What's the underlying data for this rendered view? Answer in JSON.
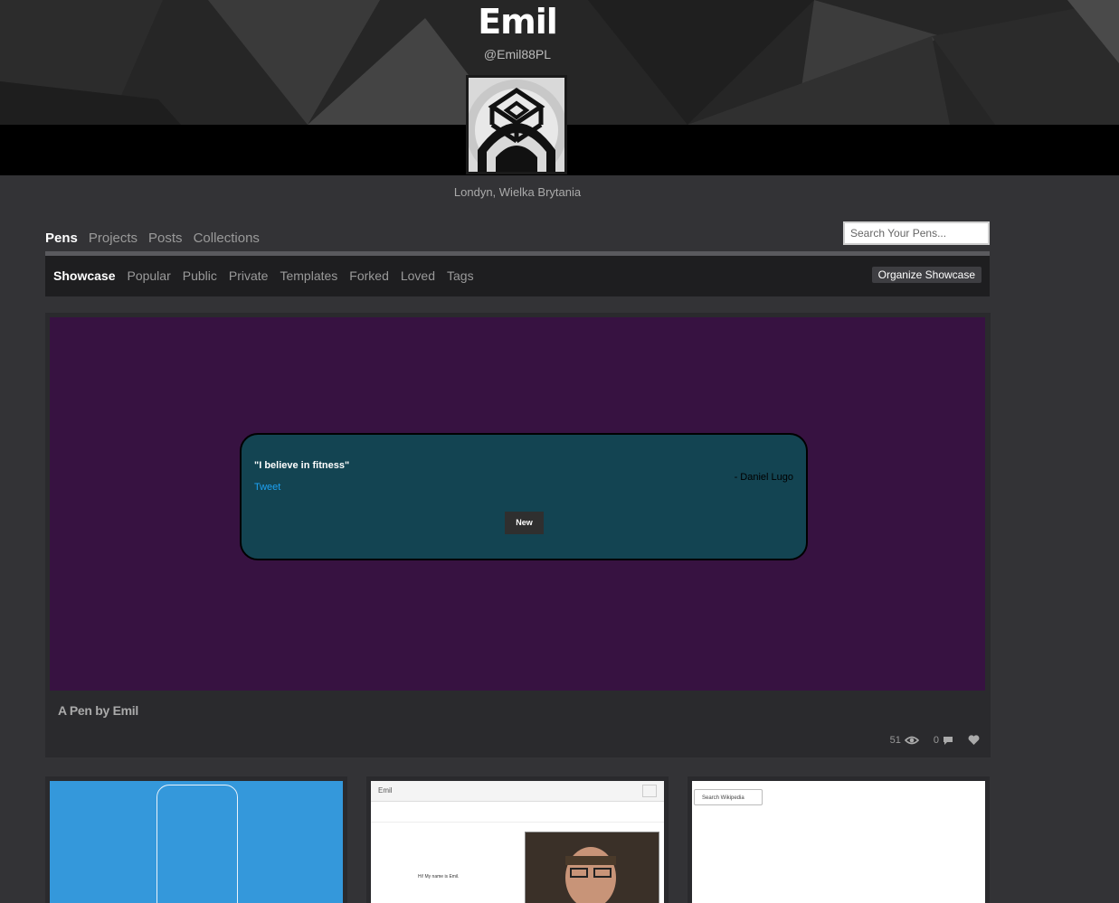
{
  "profile": {
    "name": "Emil",
    "handle": "@Emil88PL",
    "location": "Londyn, Wielka Brytania"
  },
  "main_tabs": [
    {
      "label": "Pens",
      "active": true
    },
    {
      "label": "Projects",
      "active": false
    },
    {
      "label": "Posts",
      "active": false
    },
    {
      "label": "Collections",
      "active": false
    }
  ],
  "search": {
    "placeholder": "Search Your Pens..."
  },
  "sub_tabs": [
    {
      "label": "Showcase",
      "active": true
    },
    {
      "label": "Popular",
      "active": false
    },
    {
      "label": "Public",
      "active": false
    },
    {
      "label": "Private",
      "active": false
    },
    {
      "label": "Templates",
      "active": false
    },
    {
      "label": "Forked",
      "active": false
    },
    {
      "label": "Loved",
      "active": false
    },
    {
      "label": "Tags",
      "active": false
    }
  ],
  "organize_label": "Organize Showcase",
  "featured": {
    "quote": "\"I believe in fitness\"",
    "author": "- Daniel Lugo",
    "tweet_label": "Tweet",
    "new_label": "New",
    "title": "A Pen by Emil",
    "views": "51",
    "comments": "0",
    "colors": {
      "background": "#371241",
      "quote_box": "#134452"
    }
  },
  "thumbs": [
    {
      "kind": "phone-outline",
      "color": "#3498db"
    },
    {
      "bar_label": "Emil",
      "text": "Hi! My name is Emil."
    },
    {
      "search_label": "Search Wikipedia"
    }
  ]
}
